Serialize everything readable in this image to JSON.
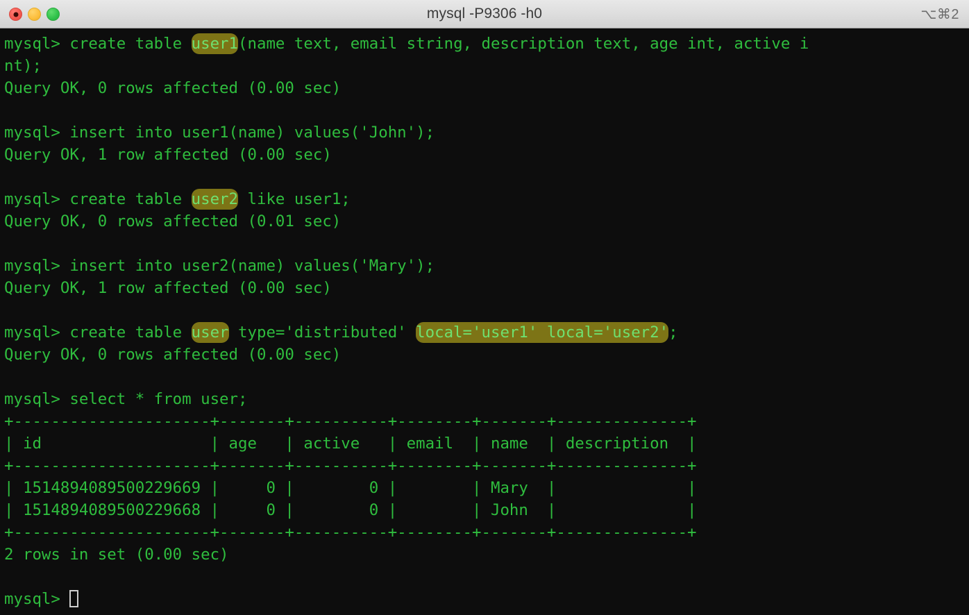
{
  "window": {
    "title": "mysql -P9306 -h0",
    "shortcut_badge": "⌥⌘2",
    "traffic_lights": {
      "close_label": "close",
      "minimize_label": "minimize",
      "maximize_label": "maximize"
    }
  },
  "theme": {
    "background": "#0d0d0d",
    "foreground": "#2fbd3e",
    "highlight_background": "#7d7416",
    "highlight_foreground": "#6fe06f",
    "titlebar_background": "#dedede",
    "titlebar_text": "#3c3c3c"
  },
  "terminal": {
    "prompt": "mysql> ",
    "lines": [
      {
        "id": "l01",
        "type": "command",
        "segments": [
          {
            "text": "mysql> create table "
          },
          {
            "text": "user1",
            "highlight": true
          },
          {
            "text": "(name text, email string, description text, age int, active i"
          }
        ]
      },
      {
        "id": "l02",
        "type": "command-wrap",
        "segments": [
          {
            "text": "nt);"
          }
        ]
      },
      {
        "id": "l03",
        "type": "output",
        "segments": [
          {
            "text": "Query OK, 0 rows affected (0.00 sec)"
          }
        ]
      },
      {
        "id": "l04",
        "type": "blank",
        "segments": [
          {
            "text": ""
          }
        ]
      },
      {
        "id": "l05",
        "type": "command",
        "segments": [
          {
            "text": "mysql> insert into user1(name) values('John');"
          }
        ]
      },
      {
        "id": "l06",
        "type": "output",
        "segments": [
          {
            "text": "Query OK, 1 row affected (0.00 sec)"
          }
        ]
      },
      {
        "id": "l07",
        "type": "blank",
        "segments": [
          {
            "text": ""
          }
        ]
      },
      {
        "id": "l08",
        "type": "command",
        "segments": [
          {
            "text": "mysql> create table "
          },
          {
            "text": "user2",
            "highlight": true
          },
          {
            "text": " like user1;"
          }
        ]
      },
      {
        "id": "l09",
        "type": "output",
        "segments": [
          {
            "text": "Query OK, 0 rows affected (0.01 sec)"
          }
        ]
      },
      {
        "id": "l10",
        "type": "blank",
        "segments": [
          {
            "text": ""
          }
        ]
      },
      {
        "id": "l11",
        "type": "command",
        "segments": [
          {
            "text": "mysql> insert into user2(name) values('Mary');"
          }
        ]
      },
      {
        "id": "l12",
        "type": "output",
        "segments": [
          {
            "text": "Query OK, 1 row affected (0.00 sec)"
          }
        ]
      },
      {
        "id": "l13",
        "type": "blank",
        "segments": [
          {
            "text": ""
          }
        ]
      },
      {
        "id": "l14",
        "type": "command",
        "segments": [
          {
            "text": "mysql> create table "
          },
          {
            "text": "user",
            "highlight": true
          },
          {
            "text": " type='distributed' "
          },
          {
            "text": "local='user1' local='user2'",
            "highlight": true
          },
          {
            "text": ";"
          }
        ]
      },
      {
        "id": "l15",
        "type": "output",
        "segments": [
          {
            "text": "Query OK, 0 rows affected (0.00 sec)"
          }
        ]
      },
      {
        "id": "l16",
        "type": "blank",
        "segments": [
          {
            "text": ""
          }
        ]
      },
      {
        "id": "l17",
        "type": "command",
        "segments": [
          {
            "text": "mysql> select * from user;"
          }
        ]
      },
      {
        "id": "l18",
        "type": "table-rule",
        "segments": [
          {
            "text": "+---------------------+-------+----------+--------+-------+--------------+"
          }
        ]
      },
      {
        "id": "l19",
        "type": "table-header",
        "segments": [
          {
            "text": "| id                  | age   | active   | email  | name  | description  |"
          }
        ]
      },
      {
        "id": "l20",
        "type": "table-rule",
        "segments": [
          {
            "text": "+---------------------+-------+----------+--------+-------+--------------+"
          }
        ]
      },
      {
        "id": "l21",
        "type": "table-row",
        "segments": [
          {
            "text": "| 1514894089500229669 |     0 |        0 |        | Mary  |              |"
          }
        ]
      },
      {
        "id": "l22",
        "type": "table-row",
        "segments": [
          {
            "text": "| 1514894089500229668 |     0 |        0 |        | John  |              |"
          }
        ]
      },
      {
        "id": "l23",
        "type": "table-rule",
        "segments": [
          {
            "text": "+---------------------+-------+----------+--------+-------+--------------+"
          }
        ]
      },
      {
        "id": "l24",
        "type": "output",
        "segments": [
          {
            "text": "2 rows in set (0.00 sec)"
          }
        ]
      },
      {
        "id": "l25",
        "type": "blank",
        "segments": [
          {
            "text": ""
          }
        ]
      },
      {
        "id": "l26",
        "type": "prompt",
        "segments": [
          {
            "text": "mysql> "
          }
        ],
        "cursor": true
      }
    ],
    "result_table": {
      "columns": [
        "id",
        "age",
        "active",
        "email",
        "name",
        "description"
      ],
      "rows": [
        {
          "id": "1514894089500229669",
          "age": "0",
          "active": "0",
          "email": "",
          "name": "Mary",
          "description": ""
        },
        {
          "id": "1514894089500229668",
          "age": "0",
          "active": "0",
          "email": "",
          "name": "John",
          "description": ""
        }
      ],
      "footer": "2 rows in set (0.00 sec)"
    }
  }
}
